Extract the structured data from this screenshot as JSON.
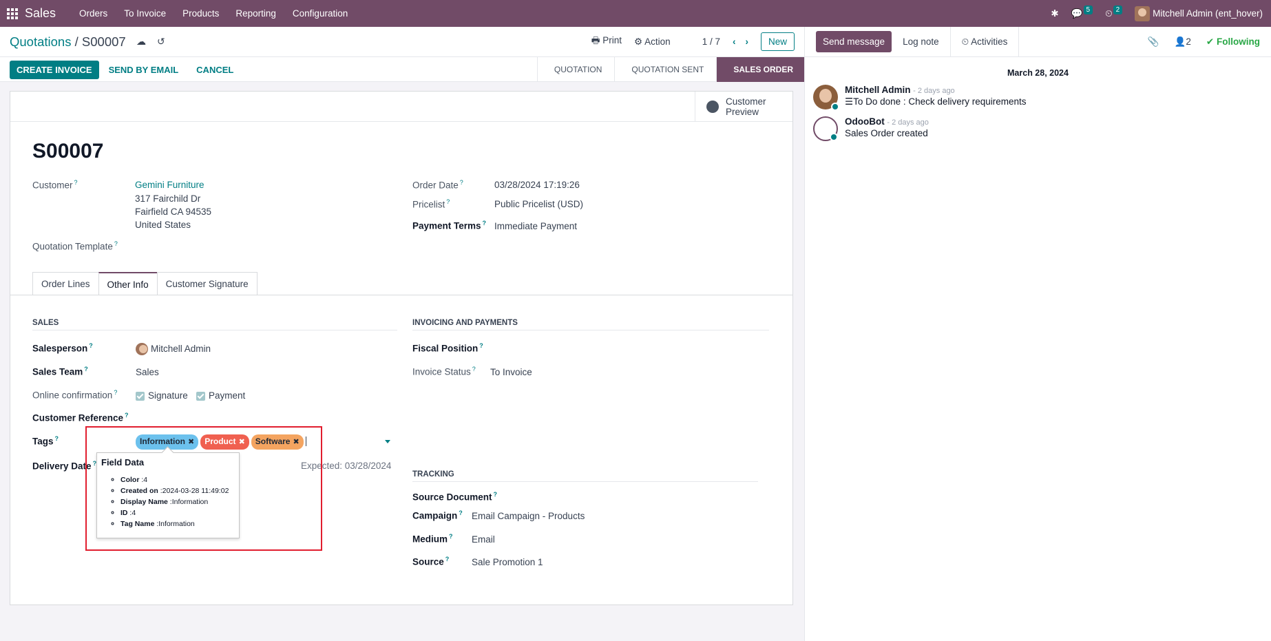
{
  "navbar": {
    "brand": "Sales",
    "menu": [
      "Orders",
      "To Invoice",
      "Products",
      "Reporting",
      "Configuration"
    ],
    "messages_count": "5",
    "activities_count": "2",
    "user": "Mitchell Admin (ent_hover)"
  },
  "control_panel": {
    "breadcrumb_parent": "Quotations",
    "breadcrumb_sep": "/",
    "breadcrumb_current": "S00007",
    "print_label": "Print",
    "action_label": "Action",
    "pager": "1 / 7",
    "new_label": "New"
  },
  "statusbar": {
    "create_invoice": "Create Invoice",
    "send_by_email": "Send by Email",
    "cancel": "Cancel",
    "stages": [
      "Quotation",
      "Quotation Sent",
      "Sales Order"
    ],
    "active_stage": "Sales Order"
  },
  "sheet": {
    "customer_preview": "Customer Preview",
    "title": "S00007",
    "customer_label": "Customer",
    "customer_name": "Gemini Furniture",
    "customer_address": [
      "317 Fairchild Dr",
      "Fairfield CA 94535",
      "United States"
    ],
    "quotation_template_label": "Quotation Template",
    "order_date_label": "Order Date",
    "order_date": "03/28/2024 17:19:26",
    "pricelist_label": "Pricelist",
    "pricelist": "Public Pricelist (USD)",
    "payment_terms_label": "Payment Terms",
    "payment_terms": "Immediate Payment",
    "tabs": [
      "Order Lines",
      "Other Info",
      "Customer Signature"
    ],
    "active_tab": "Other Info",
    "sales": {
      "heading": "Sales",
      "salesperson_label": "Salesperson",
      "salesperson": "Mitchell Admin",
      "sales_team_label": "Sales Team",
      "sales_team": "Sales",
      "online_confirmation_label": "Online confirmation",
      "signature": "Signature",
      "payment": "Payment",
      "customer_reference_label": "Customer Reference",
      "tags_label": "Tags",
      "tags": [
        "Information",
        "Product",
        "Software"
      ],
      "delivery_date_label": "Delivery Date",
      "expected": "Expected: 03/28/2024"
    },
    "invoicing": {
      "heading": "Invoicing and Payments",
      "fiscal_position_label": "Fiscal Position",
      "invoice_status_label": "Invoice Status",
      "invoice_status": "To Invoice"
    },
    "tracking": {
      "heading": "Tracking",
      "source_document_label": "Source Document",
      "campaign_label": "Campaign",
      "campaign": "Email Campaign - Products",
      "medium_label": "Medium",
      "medium": "Email",
      "source_label": "Source",
      "source": "Sale Promotion 1"
    }
  },
  "tooltip": {
    "title": "Field Data",
    "rows": [
      {
        "key": "Color",
        "value": ":4"
      },
      {
        "key": "Created on",
        "value": ":2024-03-28 11:49:02"
      },
      {
        "key": "Display Name",
        "value": ":Information"
      },
      {
        "key": "ID",
        "value": ":4"
      },
      {
        "key": "Tag Name",
        "value": ":Information"
      }
    ]
  },
  "chatter": {
    "send_message": "Send message",
    "log_note": "Log note",
    "activities": "Activities",
    "followers_count": "2",
    "following": "Following",
    "date": "March 28, 2024",
    "messages": [
      {
        "author": "Mitchell Admin",
        "time": "- 2 days ago",
        "body": "To Do done : Check delivery requirements"
      },
      {
        "author": "OdooBot",
        "time": "- 2 days ago",
        "body": "Sales Order created"
      }
    ]
  },
  "colors": {
    "brand": "#714b67",
    "accent": "#017e84",
    "tag_information": "#6cc1ed",
    "tag_product": "#f06050",
    "tag_software": "#f4a460",
    "highlight": "#e11d2e"
  }
}
